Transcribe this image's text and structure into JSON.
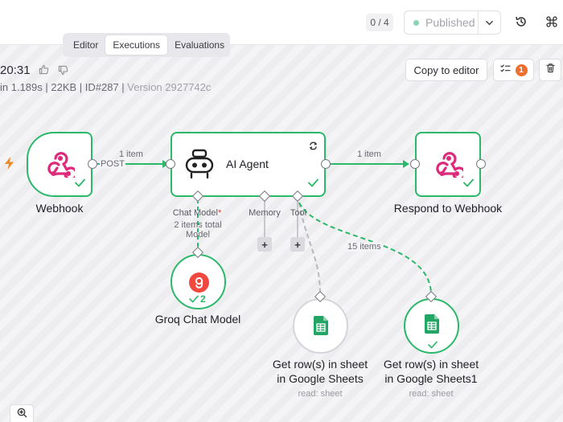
{
  "header": {
    "exec_counter": "0 / 4",
    "publish_label": "Published",
    "tabs": [
      {
        "label": "Editor"
      },
      {
        "label": "Executions"
      },
      {
        "label": "Evaluations"
      }
    ]
  },
  "execution": {
    "time_fragment": "20:31",
    "meta_main": "in 1.189s | 22KB | ID#287 | ",
    "meta_version": "Version 2927742c"
  },
  "actions": {
    "copy_label": "Copy to editor",
    "issues_count": "1"
  },
  "nodes": {
    "webhook": {
      "label": "Webhook",
      "method": "POST"
    },
    "agent": {
      "label": "AI Agent"
    },
    "respond": {
      "label": "Respond to Webhook"
    },
    "groq": {
      "label": "Groq Chat Model",
      "run_count": "2"
    },
    "sheets1": {
      "line1": "Get row(s) in sheet",
      "line2": "in Google Sheets",
      "sub": "read: sheet"
    },
    "sheets2": {
      "line1": "Get row(s) in sheet",
      "line2": "in Google Sheets1",
      "sub": "read: sheet"
    }
  },
  "ports": {
    "chat_model": "Chat Model",
    "required_mark": "*",
    "memory": "Memory",
    "tool": "Tool"
  },
  "edges": {
    "webhook_agent": "1 item",
    "agent_respond": "1 item",
    "model_line1": "2 items total",
    "model_line2": "Model",
    "tool_items": "15 items"
  },
  "colors": {
    "success": "#2bb86a",
    "webhook_pink": "#dd2a7b",
    "trigger_orange": "#f08a24",
    "groq_red": "#f0483e",
    "sheets_green": "#23a566",
    "badge_orange": "#ef6d2d"
  }
}
